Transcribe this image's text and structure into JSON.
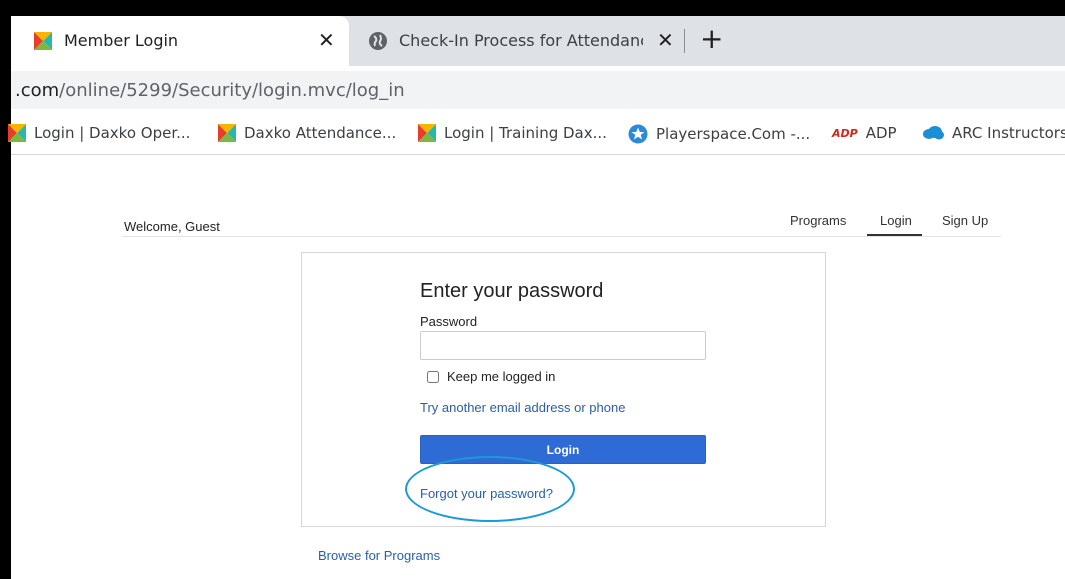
{
  "browser": {
    "tabs": [
      {
        "title": "Member Login",
        "icon": "daxko-icon",
        "active": true
      },
      {
        "title": "Check-In Process for Attendance",
        "icon": "globe-icon",
        "active": false
      }
    ],
    "close_glyph": "✕",
    "new_tab_glyph": "+",
    "address": {
      "host_part": ".com",
      "path_part": "/online/5299/Security/login.mvc/log_in"
    },
    "bookmarks": [
      {
        "label": "Login | Daxko Oper...",
        "icon": "daxko-icon"
      },
      {
        "label": "Daxko Attendance...",
        "icon": "daxko-icon"
      },
      {
        "label": "Login | Training Dax...",
        "icon": "daxko-icon"
      },
      {
        "label": "Playerspace.Com -...",
        "icon": "playerspace-icon"
      },
      {
        "label": "ADP",
        "icon": "adp-icon"
      },
      {
        "label": "ARC Instructors",
        "icon": "cloud-icon"
      }
    ]
  },
  "page": {
    "welcome": "Welcome, Guest",
    "nav": {
      "programs": "Programs",
      "login": "Login",
      "signup": "Sign Up"
    },
    "form": {
      "title": "Enter your password",
      "password_label": "Password",
      "password_value": "",
      "keep_logged_in": "Keep me logged in",
      "keep_logged_in_checked": false,
      "try_another": "Try another email address or phone",
      "login_button": "Login",
      "forgot_password": "Forgot your password?"
    },
    "browse_programs": "Browse for Programs"
  },
  "colors": {
    "link": "#2a5db0",
    "primary_button": "#2e6bd4",
    "annotation": "#1a9ad6"
  }
}
